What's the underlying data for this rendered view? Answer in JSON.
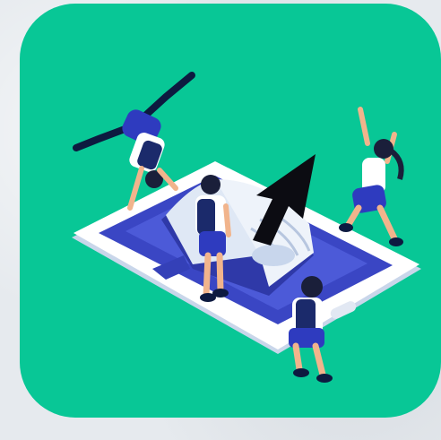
{
  "app_icon": {
    "name": "education-app-icon",
    "accent_color": "#08c796",
    "tablet_color": "#ffffff",
    "screen_color": "#3a46c4",
    "book_color": "#dfe8f5",
    "cursor_color": "#0c0c12",
    "icons": [
      "tablet-icon",
      "open-book-icon",
      "arrow-cursor-icon",
      "student-figure-icon"
    ]
  }
}
